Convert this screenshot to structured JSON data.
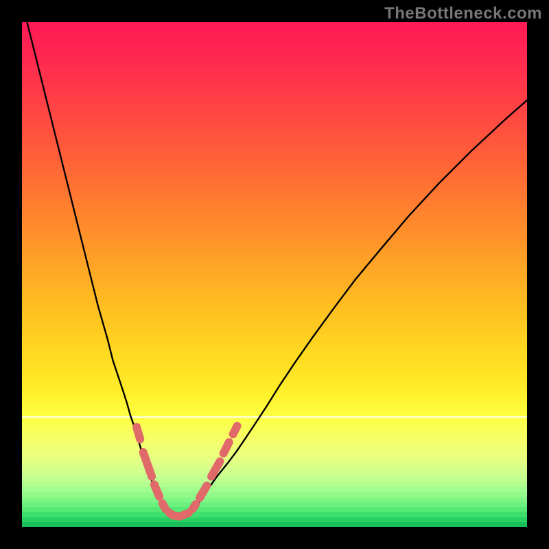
{
  "watermark": "TheBottleneck.com",
  "colors": {
    "frame_bg": "#000000",
    "curve": "#000000",
    "marker": "#e06a6a"
  },
  "gradient_stops": [
    {
      "t": 0.0,
      "color": "#ff1a55"
    },
    {
      "t": 0.07,
      "color": "#ff2850"
    },
    {
      "t": 0.15,
      "color": "#ff3e46"
    },
    {
      "t": 0.25,
      "color": "#ff5a3a"
    },
    {
      "t": 0.35,
      "color": "#ff7a30"
    },
    {
      "t": 0.45,
      "color": "#ff9a28"
    },
    {
      "t": 0.55,
      "color": "#ffba22"
    },
    {
      "t": 0.65,
      "color": "#ffd820"
    },
    {
      "t": 0.73,
      "color": "#ffee28"
    },
    {
      "t": 0.78,
      "color": "#feff42"
    },
    {
      "t": 0.83,
      "color": "#f4ff6a"
    },
    {
      "t": 0.87,
      "color": "#e4ff86"
    },
    {
      "t": 0.9,
      "color": "#c6ff90"
    },
    {
      "t": 0.93,
      "color": "#9cfd8e"
    },
    {
      "t": 0.955,
      "color": "#6ef27f"
    },
    {
      "t": 0.975,
      "color": "#3fe06c"
    },
    {
      "t": 0.99,
      "color": "#1fc95e"
    },
    {
      "t": 1.0,
      "color": "#14b553"
    }
  ],
  "band_divider": {
    "t": 0.78,
    "thickness_frac": 0.004
  },
  "chart_data": {
    "type": "line",
    "title": "",
    "xlabel": "",
    "ylabel": "",
    "xlim": [
      0,
      100
    ],
    "ylim": [
      0,
      100
    ],
    "series": [
      {
        "name": "left-branch",
        "x": [
          1,
          3,
          5,
          7,
          9,
          11,
          13,
          15,
          17,
          18,
          19,
          20,
          20.8,
          21.5,
          22.2,
          22.8,
          23.4,
          23.9,
          24.4,
          24.9,
          25.4,
          25.9,
          26.4,
          27.0,
          27.6,
          28.3,
          29.0
        ],
        "y": [
          100,
          92,
          84,
          76,
          68,
          60,
          52,
          44,
          37,
          33,
          30,
          27,
          24.5,
          22,
          20,
          18,
          16,
          14.3,
          12.8,
          11.3,
          9.9,
          8.6,
          7.3,
          6.0,
          4.8,
          3.6,
          2.6
        ]
      },
      {
        "name": "valley",
        "x": [
          29.0,
          29.7,
          30.4,
          31.1,
          31.8,
          32.6,
          33.4
        ],
        "y": [
          2.6,
          2.0,
          1.7,
          1.6,
          1.7,
          2.0,
          2.6
        ]
      },
      {
        "name": "right-branch",
        "x": [
          33.4,
          34.2,
          35.0,
          35.8,
          36.7,
          37.6,
          38.6,
          39.8,
          41.0,
          42.5,
          44.2,
          46.2,
          48.5,
          51.0,
          54.0,
          57.5,
          61.5,
          66.0,
          71.0,
          76.5,
          82.5,
          89.0,
          96.0,
          100.0
        ],
        "y": [
          2.6,
          3.6,
          4.8,
          6.0,
          7.3,
          8.6,
          10.0,
          11.5,
          13.0,
          15.0,
          17.5,
          20.5,
          24.0,
          28.0,
          32.5,
          37.5,
          43.0,
          49.0,
          55.0,
          61.5,
          68.0,
          74.5,
          81.0,
          84.5
        ]
      }
    ],
    "segments": [
      {
        "name": "left-upper",
        "x": [
          22.7,
          23.4
        ],
        "y": [
          19.8,
          17.4
        ]
      },
      {
        "name": "left-mid",
        "x": [
          24.0,
          25.7
        ],
        "y": [
          14.8,
          10.0
        ]
      },
      {
        "name": "left-low",
        "x": [
          26.2,
          27.2
        ],
        "y": [
          8.4,
          6.0
        ]
      },
      {
        "name": "left-tiny1",
        "x": [
          27.8,
          28.4
        ],
        "y": [
          4.7,
          3.6
        ]
      },
      {
        "name": "left-tiny2",
        "x": [
          29.1,
          29.6
        ],
        "y": [
          2.9,
          2.5
        ]
      },
      {
        "name": "valley-l",
        "x": [
          29.9,
          31.2
        ],
        "y": [
          2.3,
          2.1
        ]
      },
      {
        "name": "valley-r",
        "x": [
          31.8,
          33.0
        ],
        "y": [
          2.3,
          2.8
        ]
      },
      {
        "name": "right-tiny",
        "x": [
          33.8,
          34.4
        ],
        "y": [
          3.6,
          4.5
        ]
      },
      {
        "name": "right-low",
        "x": [
          35.2,
          36.6
        ],
        "y": [
          5.8,
          8.2
        ]
      },
      {
        "name": "right-mid",
        "x": [
          37.5,
          39.2
        ],
        "y": [
          10.0,
          13.0
        ]
      },
      {
        "name": "right-upper",
        "x": [
          39.9,
          41.0
        ],
        "y": [
          14.6,
          16.8
        ]
      },
      {
        "name": "right-top",
        "x": [
          41.8,
          42.6
        ],
        "y": [
          18.4,
          20.0
        ]
      }
    ]
  }
}
